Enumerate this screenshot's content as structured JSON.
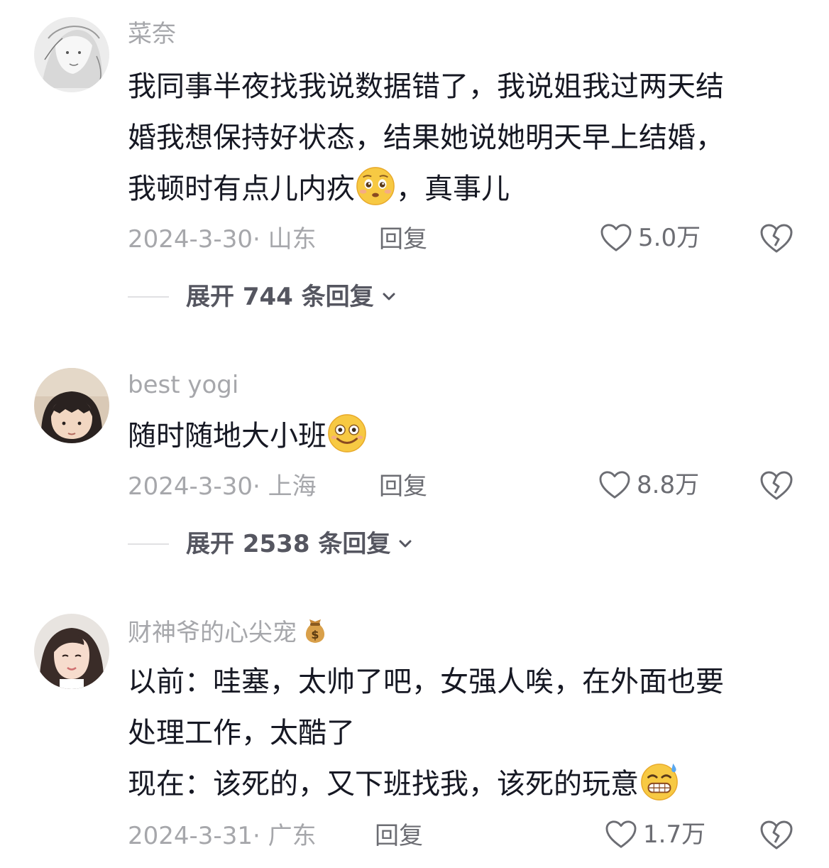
{
  "comments": [
    {
      "username": "菜奈",
      "lines": [
        "我同事半夜找我说数据错了，我说姐我过两天结",
        "婚我想保持好状态，结果她说她明天早上结婚，",
        "我顿时有点儿内疚",
        "，真事儿"
      ],
      "emoji": "pleading-face",
      "date_location": "2024-3-30· 山东",
      "reply_label": "回复",
      "likes": "5.0万",
      "expand_prefix": "展开 ",
      "expand_count": "744",
      "expand_suffix": " 条回复"
    },
    {
      "username": "best yogi",
      "lines": [
        "随时随地大小班"
      ],
      "emoji": "smiling-face",
      "date_location": "2024-3-30· 上海",
      "reply_label": "回复",
      "likes": "8.8万",
      "expand_prefix": "展开 ",
      "expand_count": "2538",
      "expand_suffix": " 条回复"
    },
    {
      "username": "财神爷的心尖宠",
      "username_icon": "money-bag",
      "lines": [
        "以前：哇塞，太帅了吧，女强人唉，在外面也要",
        "处理工作，太酷了",
        "现在：该死的，又下班找我，该死的玩意"
      ],
      "emoji": "grinning-sweat-face",
      "date_location": "2024-3-31· 广东",
      "reply_label": "回复",
      "likes": "1.7万"
    }
  ],
  "colors": {
    "text": "#161823",
    "muted": "#a6a7ab",
    "action": "#6c6d73"
  }
}
